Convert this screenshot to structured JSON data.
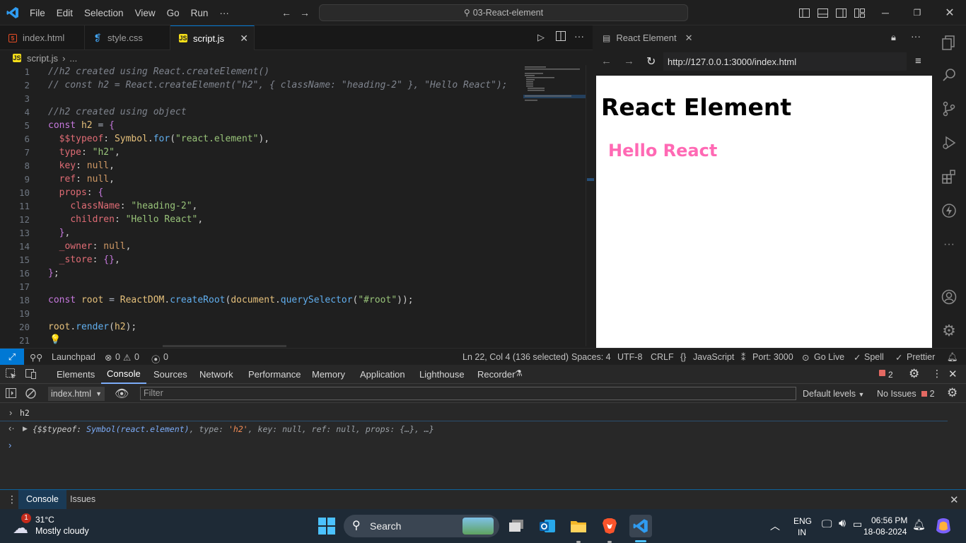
{
  "titlebar": {
    "menu": [
      "File",
      "Edit",
      "Selection",
      "View",
      "Go",
      "Run",
      "···"
    ],
    "search": "03-React-element"
  },
  "tabs": [
    {
      "label": "index.html",
      "icon": "html-file-icon"
    },
    {
      "label": "style.css",
      "icon": "css-file-icon"
    },
    {
      "label": "script.js",
      "icon": "js-file-icon",
      "active": true
    }
  ],
  "breadcrumb": {
    "file": "script.js",
    "rest": "..."
  },
  "editor": {
    "lines": [
      {
        "n": "1",
        "html": "<span class='c'>//h2 created using React.createElement()</span>"
      },
      {
        "n": "2",
        "html": "<span class='c'>// const h2 = React.createElement(\"h2\", { className: \"heading-2\" }, \"Hello React\");</span>"
      },
      {
        "n": "3",
        "html": ""
      },
      {
        "n": "4",
        "html": "<span class='c'>//h2 created using object</span>"
      },
      {
        "n": "5",
        "html": "<span class='k'>const</span> <span class='v'>h2</span> <span class='w'>=</span> <span class='k'>{</span>"
      },
      {
        "n": "6",
        "html": "  <span class='p'>$$typeof</span>: <span class='v'>Symbol</span>.<span class='f'>for</span>(<span class='s'>\"react.element\"</span>),"
      },
      {
        "n": "7",
        "html": "  <span class='p'>type</span>: <span class='s'>\"h2\"</span>,"
      },
      {
        "n": "8",
        "html": "  <span class='p'>key</span>: <span class='n'>null</span>,"
      },
      {
        "n": "9",
        "html": "  <span class='p'>ref</span>: <span class='n'>null</span>,"
      },
      {
        "n": "10",
        "html": "  <span class='p'>props</span>: <span class='k'>{</span>"
      },
      {
        "n": "11",
        "html": "    <span class='p'>className</span>: <span class='s'>\"heading-2\"</span>,"
      },
      {
        "n": "12",
        "html": "    <span class='p'>children</span>: <span class='s'>\"Hello React\"</span>,"
      },
      {
        "n": "13",
        "html": "  <span class='k'>}</span>,"
      },
      {
        "n": "14",
        "html": "  <span class='p'>_owner</span>: <span class='n'>null</span>,"
      },
      {
        "n": "15",
        "html": "  <span class='p'>_store</span>: <span class='k'>{}</span>,"
      },
      {
        "n": "16",
        "html": "<span class='k'>}</span>;"
      },
      {
        "n": "17",
        "html": ""
      },
      {
        "n": "18",
        "html": "<span class='k'>const</span> <span class='v'>root</span> <span class='w'>=</span> <span class='v'>ReactDOM</span>.<span class='f'>createRoot</span>(<span class='v'>document</span>.<span class='f'>querySelector</span>(<span class='s'>\"#root\"</span>));"
      },
      {
        "n": "19",
        "html": ""
      },
      {
        "n": "20",
        "html": "<span class='v'>root</span>.<span class='f'>render</span>(<span class='v'>h2</span>);"
      },
      {
        "n": "21",
        "html": ""
      }
    ]
  },
  "browser": {
    "tab_title": "React Element",
    "url": "http://127.0.0.1:3000/index.html",
    "heading": "React Element",
    "subheading": "Hello React"
  },
  "status": {
    "launchpad": "Launchpad",
    "errors": "0",
    "warnings": "0",
    "ports": "0",
    "cursor": "Ln 22, Col 4 (136 selected)",
    "spaces": "Spaces: 4",
    "encoding": "UTF-8",
    "eol": "CRLF",
    "language": "JavaScript",
    "port": "Port: 3000",
    "golive": "Go Live",
    "spell": "Spell",
    "prettier": "Prettier"
  },
  "devtools": {
    "tabs": [
      "Elements",
      "Console",
      "Sources",
      "Network",
      "Performance",
      "Memory",
      "Application",
      "Lighthouse",
      "Recorder"
    ],
    "active_tab": "Console",
    "issue_count": "2",
    "context": "index.html",
    "filter_placeholder": "Filter",
    "levels": "Default levels",
    "no_issues": "No Issues",
    "no_issues_count": "2",
    "input_line": "h2",
    "output_prefix": "{$$typeof: ",
    "output_symbol": "Symbol(react.element)",
    "output_type_key": ", type: ",
    "output_type_val": "'h2'",
    "output_rest": ", key: null, ref: null, props: {…}, …}",
    "drawer_tabs": [
      "Console",
      "Issues"
    ]
  },
  "taskbar": {
    "weather_temp": "31°C",
    "weather_desc": "Mostly cloudy",
    "weather_badge": "1",
    "search": "Search",
    "lang_top": "ENG",
    "lang_bottom": "IN",
    "time": "06:56 PM",
    "date": "18-08-2024"
  },
  "colors": {
    "accent": "#0078d4",
    "heading_pink": "#ff69b4",
    "taskbar": "#1e2a36"
  }
}
